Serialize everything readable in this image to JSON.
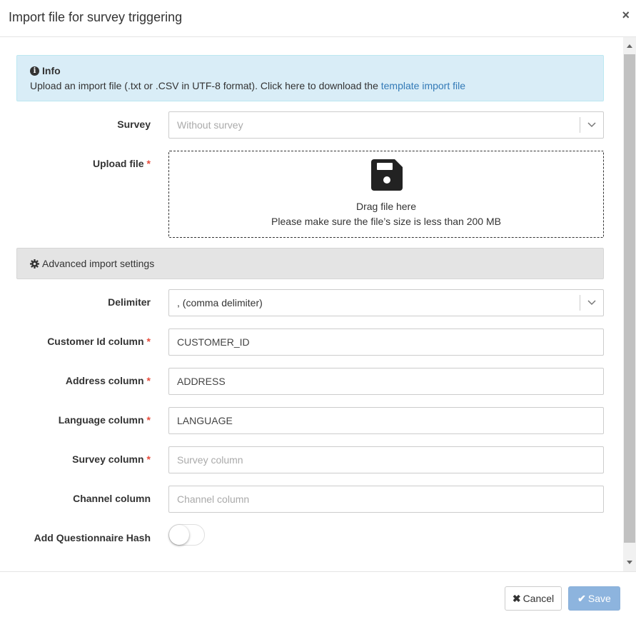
{
  "modal": {
    "title": "Import file for survey triggering",
    "close_icon": "×"
  },
  "info": {
    "icon": "i",
    "title": "Info",
    "text": "Upload an import file (.txt or .CSV in UTF-8 format). Click here to download the ",
    "link_text": "template import file"
  },
  "form": {
    "survey": {
      "label": "Survey",
      "placeholder": "Without survey"
    },
    "upload": {
      "label": "Upload file",
      "required_mark": "*",
      "drag_text": "Drag file here",
      "size_hint": "Please make sure the file’s size is less than 200 MB"
    },
    "advanced": {
      "label": "Advanced import settings"
    },
    "delimiter": {
      "label": "Delimiter",
      "value": ", (comma delimiter)"
    },
    "customer_id": {
      "label": "Customer Id column",
      "required_mark": "*",
      "value": "CUSTOMER_ID",
      "placeholder": ""
    },
    "address": {
      "label": "Address column",
      "required_mark": "*",
      "value": "ADDRESS",
      "placeholder": ""
    },
    "language": {
      "label": "Language column",
      "required_mark": "*",
      "value": "LANGUAGE",
      "placeholder": ""
    },
    "survey_column": {
      "label": "Survey column",
      "required_mark": "*",
      "value": "",
      "placeholder": "Survey column"
    },
    "channel_column": {
      "label": "Channel column",
      "value": "",
      "placeholder": "Channel column"
    },
    "questionnaire_hash": {
      "label": "Add Questionnaire Hash",
      "enabled": false
    }
  },
  "footer": {
    "cancel_icon": "✖",
    "cancel_label": "Cancel",
    "save_icon": "✔",
    "save_label": "Save"
  },
  "colors": {
    "info_bg": "#d9edf7",
    "link": "#337ab7",
    "required": "#e74c3c",
    "save_bg": "#8db4de",
    "advanced_bg": "#e4e4e4"
  }
}
